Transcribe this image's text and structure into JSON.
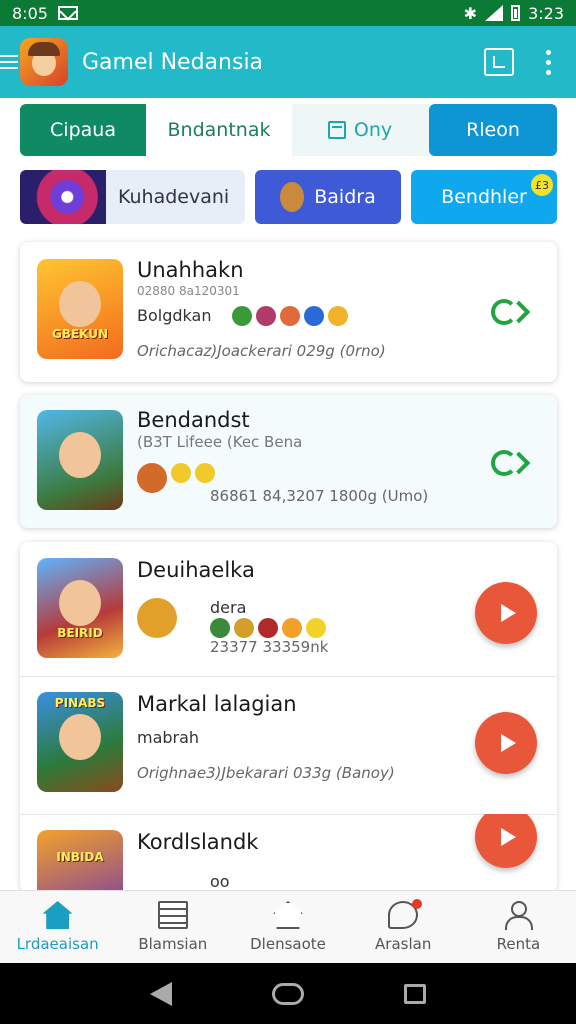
{
  "status_bar": {
    "time_left": "8:05",
    "time_right": "3:23"
  },
  "app_bar": {
    "title": "Gamel Nedansia"
  },
  "tabs": [
    {
      "label": "Cipaua"
    },
    {
      "label": "Bndantnak"
    },
    {
      "label": "Ony"
    },
    {
      "label": "Rleon"
    }
  ],
  "chips": [
    {
      "label": "Kuhadevani"
    },
    {
      "label": "Baidra"
    },
    {
      "label": "Bendhler",
      "badge": "£3"
    }
  ],
  "games": [
    {
      "title": "Unahhakn",
      "subtitle": "02880 8a120301",
      "line2": "Bolgdkan",
      "meta": "Orichacaz)Joackerari 029g (0rno)",
      "action": "chevron",
      "thumb_label": "GBEKUN"
    },
    {
      "title": "Bendandst",
      "subtitle": "(B3T Lifeee (Kec Bena",
      "line2": "",
      "meta": "86861 84,3207 1800g (Umo)",
      "action": "chevron",
      "thumb_label": ""
    },
    {
      "title": "Deuihaelka",
      "subtitle": "dera",
      "line2": "",
      "meta": "23377 33359nk",
      "action": "play",
      "thumb_label": "BEIRID"
    },
    {
      "title": "Markal lalagian",
      "subtitle": "mabrah",
      "line2": "",
      "meta": "Orighnae3)Jbekarari 033g (Banoy)",
      "action": "play",
      "thumb_label": "PINABS"
    },
    {
      "title": "Kordlslandk",
      "subtitle": "oo",
      "line2": "",
      "meta": "",
      "action": "play",
      "thumb_label": "INBIDA"
    }
  ],
  "bottom_nav": [
    {
      "label": "Lrdaeaisan",
      "icon": "home-icon",
      "active": true
    },
    {
      "label": "Blamsian",
      "icon": "list-icon",
      "active": false
    },
    {
      "label": "Dlensaote",
      "icon": "house-icon",
      "active": false
    },
    {
      "label": "Araslan",
      "icon": "chat-icon",
      "active": false
    },
    {
      "label": "Renta",
      "icon": "user-icon",
      "active": false
    }
  ],
  "colors": {
    "status_bar": "#0a7a34",
    "app_bar": "#22b9c8",
    "primary_green": "#0f8a63",
    "accent_blue": "#0e95d3",
    "play_button": "#e9573a",
    "chevron_green": "#22a53f"
  }
}
